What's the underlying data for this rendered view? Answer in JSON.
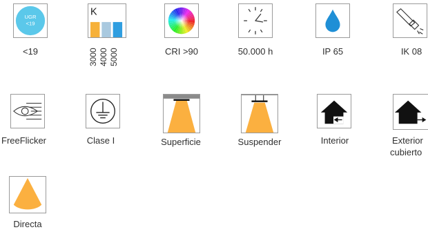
{
  "icons": [
    {
      "id": "ugr",
      "label": "<19",
      "badge_line1": "UGR",
      "badge_line2": "<19",
      "icon": "ugr-badge-icon",
      "color": "#5bc8ea"
    },
    {
      "id": "kelvin",
      "letter": "K",
      "temperatures": [
        "3000",
        "4000",
        "5000"
      ],
      "icon": "color-temperature-icon",
      "bar_colors": [
        "#f6b13a",
        "#a9c9df",
        "#2f9ee0"
      ]
    },
    {
      "id": "cri",
      "label": "CRI >90",
      "icon": "color-wheel-icon"
    },
    {
      "id": "lifetime",
      "label": "50.000 h",
      "icon": "clock-icon"
    },
    {
      "id": "ip",
      "label": "IP 65",
      "icon": "water-drop-icon",
      "color": "#1f8fd6"
    },
    {
      "id": "ik",
      "label": "IK 08",
      "icon": "hammer-impact-icon"
    },
    {
      "id": "flicker",
      "label": "FreeFlicker",
      "icon": "eye-icon"
    },
    {
      "id": "class",
      "label": "Clase I",
      "icon": "ground-symbol-icon"
    },
    {
      "id": "surface",
      "label": "Superficie",
      "icon": "surface-mount-icon",
      "color": "#fbb040"
    },
    {
      "id": "suspend",
      "label": "Suspender",
      "icon": "suspended-mount-icon",
      "color": "#fbb040"
    },
    {
      "id": "interior",
      "label": "Interior",
      "icon": "indoor-house-icon"
    },
    {
      "id": "exterior",
      "label_line1": "Exterior",
      "label_line2": "cubierto",
      "icon": "covered-outdoor-house-icon"
    },
    {
      "id": "direct",
      "label": "Directa",
      "icon": "direct-light-icon",
      "color": "#fbb040"
    }
  ]
}
